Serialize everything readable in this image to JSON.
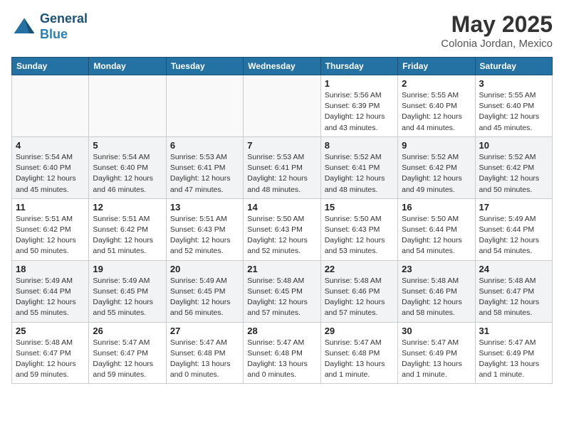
{
  "header": {
    "logo_line1": "General",
    "logo_line2": "Blue",
    "month": "May 2025",
    "location": "Colonia Jordan, Mexico"
  },
  "weekdays": [
    "Sunday",
    "Monday",
    "Tuesday",
    "Wednesday",
    "Thursday",
    "Friday",
    "Saturday"
  ],
  "weeks": [
    [
      {
        "day": "",
        "info": ""
      },
      {
        "day": "",
        "info": ""
      },
      {
        "day": "",
        "info": ""
      },
      {
        "day": "",
        "info": ""
      },
      {
        "day": "1",
        "info": "Sunrise: 5:56 AM\nSunset: 6:39 PM\nDaylight: 12 hours\nand 43 minutes."
      },
      {
        "day": "2",
        "info": "Sunrise: 5:55 AM\nSunset: 6:40 PM\nDaylight: 12 hours\nand 44 minutes."
      },
      {
        "day": "3",
        "info": "Sunrise: 5:55 AM\nSunset: 6:40 PM\nDaylight: 12 hours\nand 45 minutes."
      }
    ],
    [
      {
        "day": "4",
        "info": "Sunrise: 5:54 AM\nSunset: 6:40 PM\nDaylight: 12 hours\nand 45 minutes."
      },
      {
        "day": "5",
        "info": "Sunrise: 5:54 AM\nSunset: 6:40 PM\nDaylight: 12 hours\nand 46 minutes."
      },
      {
        "day": "6",
        "info": "Sunrise: 5:53 AM\nSunset: 6:41 PM\nDaylight: 12 hours\nand 47 minutes."
      },
      {
        "day": "7",
        "info": "Sunrise: 5:53 AM\nSunset: 6:41 PM\nDaylight: 12 hours\nand 48 minutes."
      },
      {
        "day": "8",
        "info": "Sunrise: 5:52 AM\nSunset: 6:41 PM\nDaylight: 12 hours\nand 48 minutes."
      },
      {
        "day": "9",
        "info": "Sunrise: 5:52 AM\nSunset: 6:42 PM\nDaylight: 12 hours\nand 49 minutes."
      },
      {
        "day": "10",
        "info": "Sunrise: 5:52 AM\nSunset: 6:42 PM\nDaylight: 12 hours\nand 50 minutes."
      }
    ],
    [
      {
        "day": "11",
        "info": "Sunrise: 5:51 AM\nSunset: 6:42 PM\nDaylight: 12 hours\nand 50 minutes."
      },
      {
        "day": "12",
        "info": "Sunrise: 5:51 AM\nSunset: 6:42 PM\nDaylight: 12 hours\nand 51 minutes."
      },
      {
        "day": "13",
        "info": "Sunrise: 5:51 AM\nSunset: 6:43 PM\nDaylight: 12 hours\nand 52 minutes."
      },
      {
        "day": "14",
        "info": "Sunrise: 5:50 AM\nSunset: 6:43 PM\nDaylight: 12 hours\nand 52 minutes."
      },
      {
        "day": "15",
        "info": "Sunrise: 5:50 AM\nSunset: 6:43 PM\nDaylight: 12 hours\nand 53 minutes."
      },
      {
        "day": "16",
        "info": "Sunrise: 5:50 AM\nSunset: 6:44 PM\nDaylight: 12 hours\nand 54 minutes."
      },
      {
        "day": "17",
        "info": "Sunrise: 5:49 AM\nSunset: 6:44 PM\nDaylight: 12 hours\nand 54 minutes."
      }
    ],
    [
      {
        "day": "18",
        "info": "Sunrise: 5:49 AM\nSunset: 6:44 PM\nDaylight: 12 hours\nand 55 minutes."
      },
      {
        "day": "19",
        "info": "Sunrise: 5:49 AM\nSunset: 6:45 PM\nDaylight: 12 hours\nand 55 minutes."
      },
      {
        "day": "20",
        "info": "Sunrise: 5:49 AM\nSunset: 6:45 PM\nDaylight: 12 hours\nand 56 minutes."
      },
      {
        "day": "21",
        "info": "Sunrise: 5:48 AM\nSunset: 6:45 PM\nDaylight: 12 hours\nand 57 minutes."
      },
      {
        "day": "22",
        "info": "Sunrise: 5:48 AM\nSunset: 6:46 PM\nDaylight: 12 hours\nand 57 minutes."
      },
      {
        "day": "23",
        "info": "Sunrise: 5:48 AM\nSunset: 6:46 PM\nDaylight: 12 hours\nand 58 minutes."
      },
      {
        "day": "24",
        "info": "Sunrise: 5:48 AM\nSunset: 6:47 PM\nDaylight: 12 hours\nand 58 minutes."
      }
    ],
    [
      {
        "day": "25",
        "info": "Sunrise: 5:48 AM\nSunset: 6:47 PM\nDaylight: 12 hours\nand 59 minutes."
      },
      {
        "day": "26",
        "info": "Sunrise: 5:47 AM\nSunset: 6:47 PM\nDaylight: 12 hours\nand 59 minutes."
      },
      {
        "day": "27",
        "info": "Sunrise: 5:47 AM\nSunset: 6:48 PM\nDaylight: 13 hours\nand 0 minutes."
      },
      {
        "day": "28",
        "info": "Sunrise: 5:47 AM\nSunset: 6:48 PM\nDaylight: 13 hours\nand 0 minutes."
      },
      {
        "day": "29",
        "info": "Sunrise: 5:47 AM\nSunset: 6:48 PM\nDaylight: 13 hours\nand 1 minute."
      },
      {
        "day": "30",
        "info": "Sunrise: 5:47 AM\nSunset: 6:49 PM\nDaylight: 13 hours\nand 1 minute."
      },
      {
        "day": "31",
        "info": "Sunrise: 5:47 AM\nSunset: 6:49 PM\nDaylight: 13 hours\nand 1 minute."
      }
    ]
  ]
}
